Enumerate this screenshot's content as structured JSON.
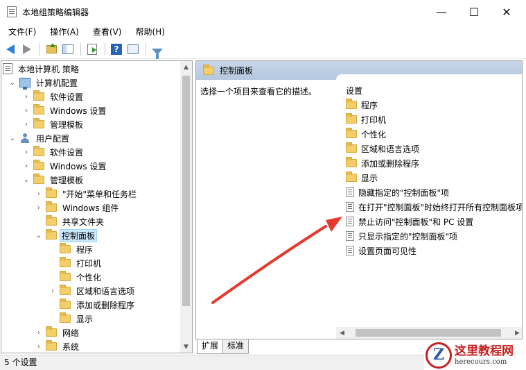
{
  "window": {
    "title": "本地组策略编辑器",
    "minimize": "—",
    "maximize": "☐",
    "close": "✕"
  },
  "menu": [
    "文件(F)",
    "操作(A)",
    "查看(V)",
    "帮助(H)"
  ],
  "toolbar": {
    "icons": [
      "back-icon",
      "forward-icon",
      "up-folder-icon",
      "show-tree-icon",
      "export-icon",
      "help-icon",
      "properties-icon",
      "filter-icon"
    ]
  },
  "tree": {
    "items": [
      {
        "label": "本地计算机 策略",
        "level": 0,
        "icon": "policy-root-icon",
        "chevron": ""
      },
      {
        "label": "计算机配置",
        "level": 1,
        "icon": "computer-icon",
        "chevron": "v"
      },
      {
        "label": "软件设置",
        "level": 2,
        "icon": "folder-icon",
        "chevron": ">"
      },
      {
        "label": "Windows 设置",
        "level": 2,
        "icon": "folder-icon",
        "chevron": ">"
      },
      {
        "label": "管理模板",
        "level": 2,
        "icon": "folder-icon",
        "chevron": ">"
      },
      {
        "label": "用户配置",
        "level": 1,
        "icon": "user-icon",
        "chevron": "v"
      },
      {
        "label": "软件设置",
        "level": 2,
        "icon": "folder-icon",
        "chevron": ">"
      },
      {
        "label": "Windows 设置",
        "level": 2,
        "icon": "folder-icon",
        "chevron": ">"
      },
      {
        "label": "管理模板",
        "level": 2,
        "icon": "folder-icon",
        "chevron": "v"
      },
      {
        "label": "\"开始\"菜单和任务栏",
        "level": 3,
        "icon": "folder-icon",
        "chevron": ">"
      },
      {
        "label": "Windows 组件",
        "level": 3,
        "icon": "folder-icon",
        "chevron": ">"
      },
      {
        "label": "共享文件夹",
        "level": 3,
        "icon": "folder-icon",
        "chevron": ""
      },
      {
        "label": "控制面板",
        "level": 3,
        "icon": "folder-icon",
        "chevron": "v",
        "selected": true
      },
      {
        "label": "程序",
        "level": 4,
        "icon": "folder-icon",
        "chevron": ""
      },
      {
        "label": "打印机",
        "level": 4,
        "icon": "folder-icon",
        "chevron": ""
      },
      {
        "label": "个性化",
        "level": 4,
        "icon": "folder-icon",
        "chevron": ""
      },
      {
        "label": "区域和语言选项",
        "level": 4,
        "icon": "folder-icon",
        "chevron": ">"
      },
      {
        "label": "添加或删除程序",
        "level": 4,
        "icon": "folder-icon",
        "chevron": ""
      },
      {
        "label": "显示",
        "level": 4,
        "icon": "folder-icon",
        "chevron": ""
      },
      {
        "label": "网络",
        "level": 3,
        "icon": "folder-icon",
        "chevron": ">"
      },
      {
        "label": "系统",
        "level": 3,
        "icon": "folder-icon",
        "chevron": ">"
      }
    ]
  },
  "right_pane": {
    "header": "控制面板",
    "description": "选择一个项目来查看它的描述。",
    "list_header": "设置",
    "items": [
      {
        "label": "程序",
        "icon": "folder-icon"
      },
      {
        "label": "打印机",
        "icon": "folder-icon"
      },
      {
        "label": "个性化",
        "icon": "folder-icon"
      },
      {
        "label": "区域和语言选项",
        "icon": "folder-icon"
      },
      {
        "label": "添加或删除程序",
        "icon": "folder-icon"
      },
      {
        "label": "显示",
        "icon": "folder-icon"
      },
      {
        "label": "隐藏指定的\"控制面板\"项",
        "icon": "setting-icon"
      },
      {
        "label": "在打开\"控制面板\"时始终打开所有控制面板项",
        "icon": "setting-icon"
      },
      {
        "label": "禁止访问\"控制面板\"和 PC 设置",
        "icon": "setting-icon"
      },
      {
        "label": "只显示指定的\"控制面板\"项",
        "icon": "setting-icon"
      },
      {
        "label": "设置页面可见性",
        "icon": "setting-icon"
      }
    ]
  },
  "tabs": [
    "扩展",
    "标准"
  ],
  "status": "5 个设置",
  "watermark": {
    "cn": "这里教程网",
    "en": "herecours.com"
  },
  "colors": {
    "header_bg": "#b5c8df",
    "selected_bg": "#cce8ff",
    "annotation_arrow": "#e8392d"
  }
}
